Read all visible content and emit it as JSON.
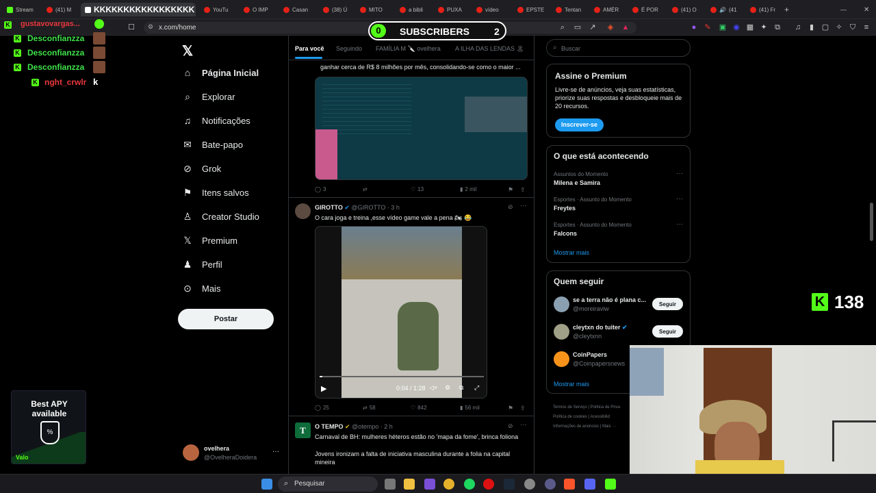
{
  "browser": {
    "tabs": [
      "Stream",
      "(41) M",
      "KKKKKKKKKKKKKKKKK",
      "YouTu",
      "O IMP",
      "Casan",
      "(38) Ú",
      "MITO",
      "a bibli",
      "PUXA",
      "vídeo",
      "EPSTE",
      "Tentan",
      "AMÉR",
      "É POR",
      "(41) O",
      "(41",
      "(41) Fr"
    ],
    "url": "x.com/home",
    "new_tab_icon": "plus-icon"
  },
  "sidebar": {
    "items": [
      {
        "label": "Página Inicial",
        "icon": "home-icon"
      },
      {
        "label": "Explorar",
        "icon": "search-icon"
      },
      {
        "label": "Notificações",
        "icon": "bell-icon"
      },
      {
        "label": "Bate-papo",
        "icon": "mail-icon"
      },
      {
        "label": "Grok",
        "icon": "grok-icon"
      },
      {
        "label": "Itens salvos",
        "icon": "bookmark-icon"
      },
      {
        "label": "Creator Studio",
        "icon": "creator-icon"
      },
      {
        "label": "Premium",
        "icon": "x-logo-icon"
      },
      {
        "label": "Perfil",
        "icon": "person-icon"
      },
      {
        "label": "Mais",
        "icon": "more-circle-icon"
      }
    ],
    "post_label": "Postar",
    "account": {
      "name": "ovelhera",
      "handle": "@OvelheraDoidera",
      "menu": "···"
    }
  },
  "feed": {
    "tabs": [
      "Para você",
      "Seguindo",
      "FAMÍLIA M 🔪 ovelhera",
      "A ILHA DAS LENDAS 🏝"
    ],
    "tweet1": {
      "text_partial": "ganhar cerca de R$ 8 milhões por mês, consolidando-se como o maior ...",
      "replies": "3",
      "retweets": "",
      "likes": "13",
      "views": "2 mil"
    },
    "tweet2": {
      "name": "GIROTTO",
      "handle": "@GIROTTO",
      "time": "· 3 h",
      "text": "O cara joga e treina ,esse vídeo game vale a pena 🏍 😂",
      "video_time": "0:04 / 1:28",
      "replies": "25",
      "retweets": "58",
      "likes": "842",
      "views": "56 mil"
    },
    "tweet3": {
      "name": "O TEMPO",
      "handle": "@otempo",
      "time": "· 2 h",
      "text1": "Carnaval de BH: mulheres héteros estão no 'mapa da fome', brinca foliona",
      "text2": "Jovens ironizam a falta de iniciativa masculina durante a folia na capital mineira"
    }
  },
  "right": {
    "search_placeholder": "Buscar",
    "premium": {
      "title": "Assine o Premium",
      "body": "Livre-se de anúncios, veja suas estatísticas, priorize suas respostas e desbloqueie mais de 20 recursos.",
      "button": "Inscrever-se"
    },
    "trends": {
      "title": "O que está acontecendo",
      "items": [
        {
          "context": "Assuntos do Momento",
          "name": "Milena e Samira"
        },
        {
          "context": "Esportes · Assunto do Momento",
          "name": "Freytes"
        },
        {
          "context": "Esportes · Assunto do Momento",
          "name": "Falcons"
        }
      ],
      "more": "Mostrar mais"
    },
    "who": {
      "title": "Quem seguir",
      "items": [
        {
          "name": "se a terra não é plana c...",
          "handle": "@moreiraviw",
          "button": "Seguir"
        },
        {
          "name": "cleytxn do tuiter",
          "handle": "@cleytxnn",
          "button": "Seguir"
        },
        {
          "name": "CoinPapers",
          "handle": "@Coinpapersnews",
          "button": ""
        }
      ],
      "more": "Mostrar mais"
    },
    "footer": [
      "Termos de Serviço",
      "Política de Priva",
      "Política de cookies",
      "Acessibilid",
      "Informações de anúncios",
      "Mais ···"
    ]
  },
  "overlay": {
    "subscribers_label": "SUBSCRIBERS",
    "subscribers_left": "0",
    "subscribers_right": "2",
    "chat": [
      "Desconfianzza",
      "Desconfianzza",
      "Desconfianzza",
      "nght_crwlr"
    ],
    "chat_top_user": "gustavovargas...",
    "chat_last_msg": "k",
    "kick_count": "138",
    "ad_line1": "Best APY",
    "ad_line2": "available",
    "ad_brand": "Valo"
  },
  "taskbar": {
    "search_label": "Pesquisar"
  },
  "colors": {
    "accent": "#1d9bf0",
    "kick_green": "#53fc18",
    "chat_red": "#e8383d"
  }
}
